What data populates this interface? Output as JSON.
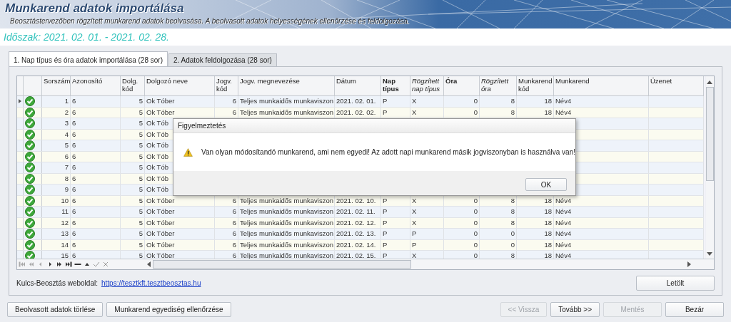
{
  "header": {
    "title": "Munkarend adatok importálása",
    "subtitle": "Beosztástervezőben rögzített munkarend adatok beolvasása. A beolvasott adatok helyességének ellenőrzése és feldolgozása.",
    "period": "Időszak: 2021. 02. 01. - 2021. 02. 28."
  },
  "tabs": [
    {
      "label": "1. Nap típus és óra adatok importálása (28 sor)",
      "selected": true
    },
    {
      "label": "2. Adatok feldolgozása (28 sor)",
      "selected": false
    }
  ],
  "table": {
    "columns": [
      "Sorszám",
      "Azonosító",
      "Dolg. kód",
      "Dolgozó neve",
      "Jogv. kód",
      "Jogv. megnevezése",
      "Dátum",
      "Nap típus",
      "Rögzített nap típus",
      "Óra",
      "Rögzített óra",
      "Munkarend kód",
      "Munkarend",
      "Üzenet"
    ],
    "rows": [
      {
        "selected": true,
        "kind": "ok",
        "cells": [
          "1",
          "6",
          "5",
          "Ok Tóber",
          "6",
          "Teljes munkaidős munkaviszon",
          "2021. 02. 01.",
          "P",
          "X",
          "0",
          "8",
          "18",
          "Név4"
        ]
      },
      {
        "selected": false,
        "kind": "ok",
        "cells": [
          "2",
          "6",
          "5",
          "Ok Tóber",
          "6",
          "Teljes munkaidős munkaviszon",
          "2021. 02. 02.",
          "P",
          "X",
          "0",
          "8",
          "18",
          "Név4"
        ]
      },
      {
        "selected": false,
        "kind": "ok",
        "cells": [
          "3",
          "6",
          "5",
          "Ok Tób"
        ]
      },
      {
        "selected": false,
        "kind": "ok",
        "cells": [
          "4",
          "6",
          "5",
          "Ok Tób"
        ]
      },
      {
        "selected": false,
        "kind": "ok",
        "cells": [
          "5",
          "6",
          "5",
          "Ok Tób"
        ]
      },
      {
        "selected": false,
        "kind": "ok",
        "cells": [
          "6",
          "6",
          "5",
          "Ok Tób"
        ]
      },
      {
        "selected": false,
        "kind": "ok",
        "cells": [
          "7",
          "6",
          "5",
          "Ok Tób"
        ]
      },
      {
        "selected": false,
        "kind": "ok",
        "cells": [
          "8",
          "6",
          "5",
          "Ok Tób"
        ]
      },
      {
        "selected": false,
        "kind": "ok",
        "cells": [
          "9",
          "6",
          "5",
          "Ok Tób"
        ]
      },
      {
        "selected": false,
        "kind": "ok",
        "cells": [
          "10",
          "6",
          "5",
          "Ok Tóber",
          "6",
          "Teljes munkaidős munkaviszon",
          "2021. 02. 10.",
          "P",
          "X",
          "0",
          "8",
          "18",
          "Név4"
        ]
      },
      {
        "selected": false,
        "kind": "ok",
        "cells": [
          "11",
          "6",
          "5",
          "Ok Tóber",
          "6",
          "Teljes munkaidős munkaviszon",
          "2021. 02. 11.",
          "P",
          "X",
          "0",
          "8",
          "18",
          "Név4"
        ]
      },
      {
        "selected": false,
        "kind": "ok",
        "cells": [
          "12",
          "6",
          "5",
          "Ok Tóber",
          "6",
          "Teljes munkaidős munkaviszon",
          "2021. 02. 12.",
          "P",
          "X",
          "0",
          "8",
          "18",
          "Név4"
        ]
      },
      {
        "selected": false,
        "kind": "ok",
        "cells": [
          "13",
          "6",
          "5",
          "Ok Tóber",
          "6",
          "Teljes munkaidős munkaviszon",
          "2021. 02. 13.",
          "P",
          "P",
          "0",
          "0",
          "18",
          "Név4"
        ]
      },
      {
        "selected": false,
        "kind": "ok",
        "cells": [
          "14",
          "6",
          "5",
          "Ok Tóber",
          "6",
          "Teljes munkaidős munkaviszon",
          "2021. 02. 14.",
          "P",
          "P",
          "0",
          "0",
          "18",
          "Név4"
        ]
      },
      {
        "selected": false,
        "kind": "ok",
        "cells": [
          "15",
          "6",
          "5",
          "Ok Tóber",
          "6",
          "Teljes munkaidős munkaviszon",
          "2021. 02. 15.",
          "P",
          "X",
          "0",
          "8",
          "18",
          "Név4"
        ]
      }
    ]
  },
  "link": {
    "label": "Kulcs-Beosztás weboldal:",
    "url": "https://tesztkft.tesztbeosztas.hu"
  },
  "download_button": "Letölt",
  "left_buttons": [
    {
      "label": "Beolvasott adatok törlése",
      "disabled": false
    },
    {
      "label": "Munkarend egyediség ellenőrzése",
      "disabled": false
    }
  ],
  "right_buttons": [
    {
      "label": "<< Vissza",
      "disabled": true
    },
    {
      "label": "Tovább >>",
      "disabled": false
    },
    {
      "label": "Mentés",
      "disabled": true
    },
    {
      "label": "Bezár",
      "disabled": false
    }
  ],
  "dialog": {
    "title": "Figyelmeztetés",
    "kind": "warning",
    "message": "Van olyan módosítandó munkarend, ami nem egyedi! Az adott napi munkarend másik jogviszonyban is használva van!",
    "button": "OK"
  }
}
